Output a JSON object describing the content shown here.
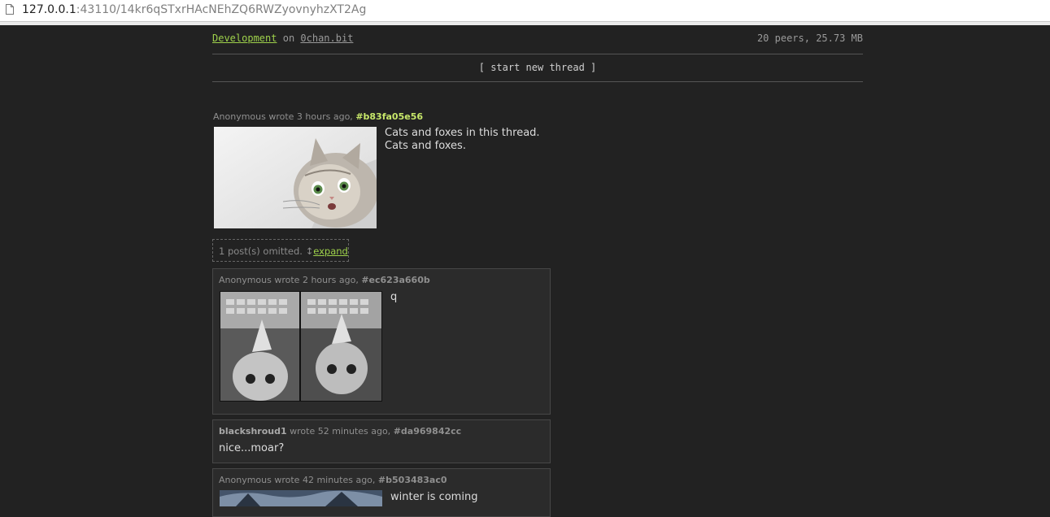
{
  "browser": {
    "url_host": "127.0.0.1",
    "url_rest": ":43110/14kr6qSTxrHAcNEhZQ6RWZyovnyhzXT2Ag"
  },
  "board": {
    "name": "Development",
    "on_label": "on",
    "site": "0chan.bit",
    "stats": "20 peers, 25.73 MB",
    "new_thread_label": "[ start new thread ]"
  },
  "thread": {
    "op": {
      "meta": "Anonymous wrote 3 hours ago,",
      "hash": "#b83fa05e56",
      "lines": [
        "Cats and foxes in this thread.",
        "Cats and foxes."
      ],
      "image_icon": "cat-photo"
    },
    "omitted": {
      "text": "1 post(s) omitted.",
      "arrow": "↕",
      "expand_label": "expand"
    },
    "replies": [
      {
        "author": "Anonymous",
        "meta": "wrote 2 hours ago,",
        "hash": "#ec623a660b",
        "text": "q",
        "image_icon": "cat-keyboard-photo"
      },
      {
        "author": "blackshroud1",
        "meta": "wrote 52 minutes ago,",
        "hash": "#da969842cc",
        "text": "nice...moar?"
      },
      {
        "author": "Anonymous",
        "meta": "wrote 42 minutes ago,",
        "hash": "#b503483ac0",
        "text": "winter is coming",
        "image_icon": "winter-photo"
      }
    ]
  },
  "colors": {
    "background": "#222222",
    "accent_green": "#9ed14b",
    "hash_green": "#c8e86a"
  }
}
